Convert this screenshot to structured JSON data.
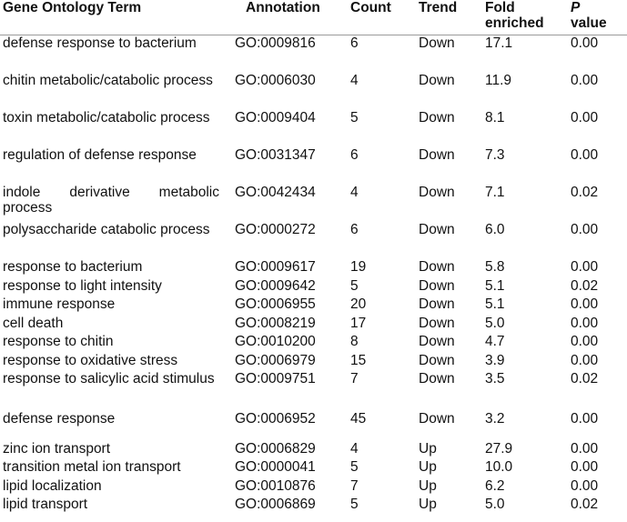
{
  "header": {
    "term": "Gene Ontology Term",
    "annotation": "Annotation",
    "count": "Count",
    "trend": "Trend",
    "fold_line1": "Fold",
    "fold_line2": "enriched",
    "p_line1": "P",
    "p_line2": "value"
  },
  "rows": [
    {
      "term": "defense response to bacterium",
      "annotation": "GO:0009816",
      "count": "6",
      "trend": "Down",
      "fold": "17.1",
      "p": "0.00"
    },
    {
      "term": "chitin metabolic/catabolic process",
      "annotation": "GO:0006030",
      "count": "4",
      "trend": "Down",
      "fold": "11.9",
      "p": "0.00"
    },
    {
      "term": "toxin metabolic/catabolic process",
      "annotation": "GO:0009404",
      "count": "5",
      "trend": "Down",
      "fold": "8.1",
      "p": "0.00"
    },
    {
      "term": "regulation of defense response",
      "annotation": "GO:0031347",
      "count": "6",
      "trend": "Down",
      "fold": "7.3",
      "p": "0.00"
    },
    {
      "term": "indole derivative metabolic process",
      "annotation": "GO:0042434",
      "count": "4",
      "trend": "Down",
      "fold": "7.1",
      "p": "0.02"
    },
    {
      "term": "polysaccharide catabolic process",
      "annotation": "GO:0000272",
      "count": "6",
      "trend": "Down",
      "fold": "6.0",
      "p": "0.00"
    },
    {
      "term": "response to bacterium",
      "annotation": "GO:0009617",
      "count": "19",
      "trend": "Down",
      "fold": "5.8",
      "p": "0.00"
    },
    {
      "term": "response to light intensity",
      "annotation": "GO:0009642",
      "count": "5",
      "trend": "Down",
      "fold": "5.1",
      "p": "0.02"
    },
    {
      "term": "immune response",
      "annotation": "GO:0006955",
      "count": "20",
      "trend": "Down",
      "fold": "5.1",
      "p": "0.00"
    },
    {
      "term": "cell death",
      "annotation": "GO:0008219",
      "count": "17",
      "trend": "Down",
      "fold": "5.0",
      "p": "0.00"
    },
    {
      "term": "response to chitin",
      "annotation": "GO:0010200",
      "count": "8",
      "trend": "Down",
      "fold": "4.7",
      "p": "0.00"
    },
    {
      "term": "response to oxidative stress",
      "annotation": "GO:0006979",
      "count": "15",
      "trend": "Down",
      "fold": "3.9",
      "p": "0.00"
    },
    {
      "term": "response to salicylic acid stimulus",
      "annotation": "GO:0009751",
      "count": "7",
      "trend": "Down",
      "fold": "3.5",
      "p": "0.02"
    },
    {
      "term": "defense response",
      "annotation": "GO:0006952",
      "count": "45",
      "trend": "Down",
      "fold": "3.2",
      "p": "0.00"
    },
    {
      "term": "zinc ion transport",
      "annotation": "GO:0006829",
      "count": "4",
      "trend": "Up",
      "fold": "27.9",
      "p": "0.00"
    },
    {
      "term": "transition metal ion transport",
      "annotation": "GO:0000041",
      "count": "5",
      "trend": "Up",
      "fold": "10.0",
      "p": "0.00"
    },
    {
      "term": "lipid localization",
      "annotation": "GO:0010876",
      "count": "7",
      "trend": "Up",
      "fold": "6.2",
      "p": "0.00"
    },
    {
      "term": "lipid transport",
      "annotation": "GO:0006869",
      "count": "5",
      "trend": "Up",
      "fold": "5.0",
      "p": "0.02"
    }
  ]
}
